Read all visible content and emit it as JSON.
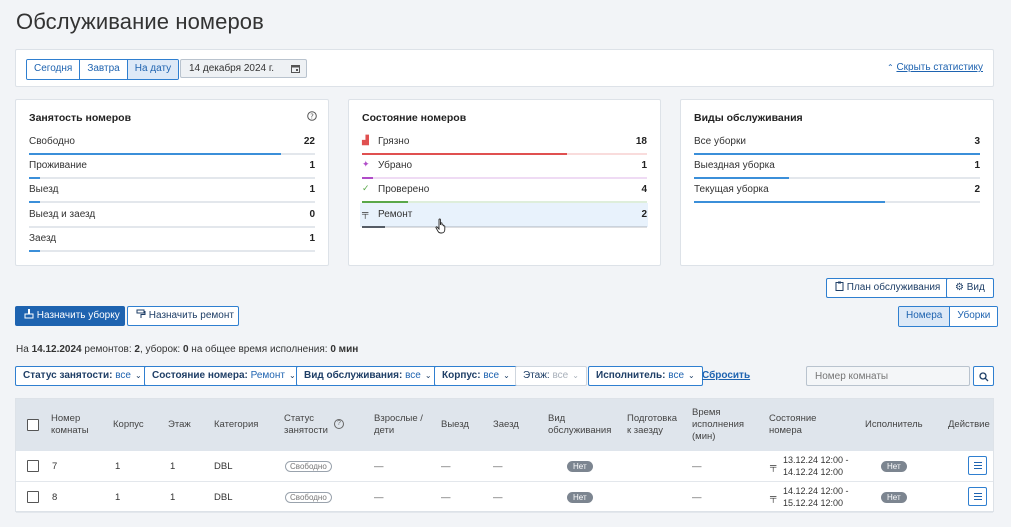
{
  "page_title": "Обслуживание номеров",
  "toolbar": {
    "tabs": [
      "Сегодня",
      "Завтра",
      "На дату"
    ],
    "active_tab": "На дату",
    "date_value": "14 декабря 2024 г.",
    "hide_stats_label": "Скрыть статистику"
  },
  "occupancy": {
    "title": "Занятость номеров",
    "rows": [
      {
        "label": "Свободно",
        "count": "22",
        "fraction": 0.88
      },
      {
        "label": "Проживание",
        "count": "1",
        "fraction": 0.04
      },
      {
        "label": "Выезд",
        "count": "1",
        "fraction": 0.04
      },
      {
        "label": "Выезд и заезд",
        "count": "0",
        "fraction": 0.0
      },
      {
        "label": "Заезд",
        "count": "1",
        "fraction": 0.04
      }
    ]
  },
  "room_state": {
    "title": "Состояние номеров",
    "rows": [
      {
        "label": "Грязно",
        "count": "18",
        "fraction": 0.72,
        "color": "#e05050",
        "icon": "broom-icon"
      },
      {
        "label": "Убрано",
        "count": "1",
        "fraction": 0.04,
        "color": "#b04cc8",
        "icon": "sparkle-icon"
      },
      {
        "label": "Проверено",
        "count": "4",
        "fraction": 0.16,
        "color": "#5aa84a",
        "icon": "check-icon"
      },
      {
        "label": "Ремонт",
        "count": "2",
        "fraction": 0.08,
        "color": "#555c66",
        "icon": "paint-roller-icon"
      }
    ]
  },
  "service_types": {
    "title": "Виды обслуживания",
    "rows": [
      {
        "label": "Все уборки",
        "count": "3",
        "fraction": 1.0
      },
      {
        "label": "Выездная уборка",
        "count": "1",
        "fraction": 0.333
      },
      {
        "label": "Текущая уборка",
        "count": "2",
        "fraction": 0.667
      }
    ]
  },
  "actions": {
    "plan_label": "План обслуживания",
    "view_label": "Вид",
    "assign_cleaning": "Назначить уборку",
    "assign_repair": "Назначить ремонт",
    "toggle_rooms": "Номера",
    "toggle_cleanings": "Уборки"
  },
  "summary": {
    "prefix": "На ",
    "date": "14.12.2024",
    "repairs_label": " ремонтов: ",
    "repairs": "2",
    "cleanings_label": ", уборок: ",
    "cleanings": "0",
    "time_label": " на общее время исполнения: ",
    "time": "0 мин"
  },
  "filters": [
    {
      "label": "Статус занятости:",
      "value": "все",
      "enabled": true
    },
    {
      "label": "Состояние номера:",
      "value": "Ремонт",
      "enabled": true
    },
    {
      "label": "Вид обслуживания:",
      "value": "все",
      "enabled": true
    },
    {
      "label": "Корпус:",
      "value": "все",
      "enabled": true
    },
    {
      "label": "Этаж:",
      "value": "все",
      "enabled": false
    },
    {
      "label": "Исполнитель:",
      "value": "все",
      "enabled": true
    }
  ],
  "reset_label": "Сбросить",
  "room_search_placeholder": "Номер комнаты",
  "table": {
    "headers": [
      "Номер\nкомнаты",
      "Корпус",
      "Этаж",
      "Категория",
      "Статус\nзанятости",
      "Взрослые /\nдети",
      "Выезд",
      "Заезд",
      "Вид\nобслуживания",
      "Подготовка\nк заезду",
      "Время\nисполнения\n(мин)",
      "Состояние\nномера",
      "Исполнитель",
      "Действие"
    ],
    "rows": [
      {
        "room": "7",
        "building": "1",
        "floor": "1",
        "category": "DBL",
        "status": "Свободно",
        "guests": "—",
        "checkout": "—",
        "checkin": "—",
        "service": "Нет",
        "prep": "",
        "time": "—",
        "state_line1": "13.12.24 12:00 -",
        "state_line2": "14.12.24 12:00",
        "executor": "Нет"
      },
      {
        "room": "8",
        "building": "1",
        "floor": "1",
        "category": "DBL",
        "status": "Свободно",
        "guests": "—",
        "checkout": "—",
        "checkin": "—",
        "service": "Нет",
        "prep": "",
        "time": "—",
        "state_line1": "14.12.24 12:00 -",
        "state_line2": "15.12.24 12:00",
        "executor": "Нет"
      }
    ]
  }
}
